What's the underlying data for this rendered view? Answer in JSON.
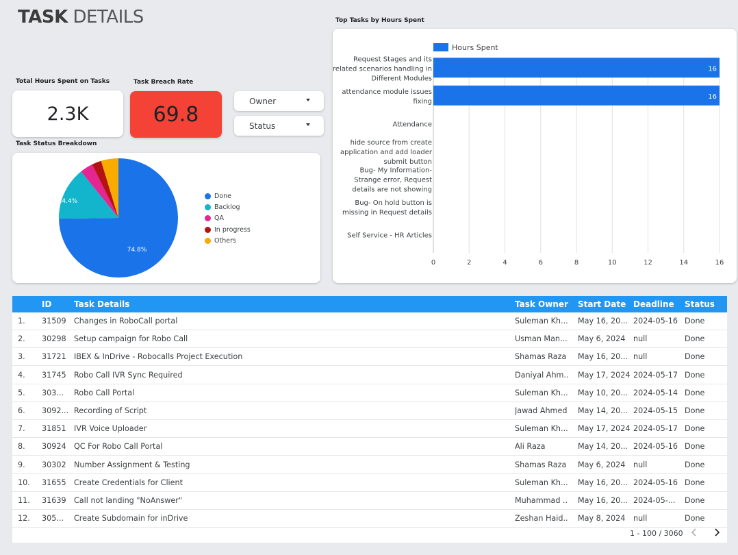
{
  "header": {
    "title_bold": "TASK",
    "title_light": "DETAILS"
  },
  "kpis": {
    "total_hours_label": "Total Hours Spent on Tasks",
    "total_hours_value": "2.3K",
    "breach_label": "Task Breach Rate",
    "breach_value": "69.8",
    "breach_color": "#f44336"
  },
  "filters": {
    "owner_label": "Owner",
    "status_label": "Status"
  },
  "status_breakdown": {
    "title": "Task Status Breakdown",
    "legend": [
      {
        "label": "Done",
        "color": "#1a73e8"
      },
      {
        "label": "Backlog",
        "color": "#12b5cb"
      },
      {
        "label": "QA",
        "color": "#e52592"
      },
      {
        "label": "In progress",
        "color": "#b31412"
      },
      {
        "label": "Others",
        "color": "#f9ab00"
      }
    ],
    "pct_labels": {
      "done": "74.8%",
      "backlog": "14.4%"
    }
  },
  "chart_data": [
    {
      "type": "pie",
      "title": "Task Status Breakdown",
      "labels": [
        "Done",
        "Backlog",
        "QA",
        "In progress",
        "Others"
      ],
      "values": [
        74.8,
        14.4,
        3.5,
        2.6,
        4.7
      ],
      "colors": [
        "#1a73e8",
        "#12b5cb",
        "#e52592",
        "#b31412",
        "#f9ab00"
      ]
    },
    {
      "type": "bar",
      "orientation": "horizontal",
      "title": "Top Tasks by Hours Spent",
      "legend": [
        "Hours Spent"
      ],
      "categories": [
        [
          "Request Stages and its",
          "related scenarios handling in",
          "Different Modules"
        ],
        [
          "attendance module issues",
          "fixing"
        ],
        [
          "Attendance"
        ],
        [
          "hide source from create",
          "application and add loader",
          "submit button"
        ],
        [
          "Bug- My Information-",
          "Strange error, Request",
          "details are not showing"
        ],
        [
          "Bug- On hold button is",
          "missing in Request details"
        ],
        [
          "Self Service - HR Articles"
        ]
      ],
      "values": [
        16,
        16,
        null,
        null,
        null,
        null,
        null
      ],
      "data_labels": [
        "16",
        "16"
      ],
      "xlim": [
        0,
        16
      ],
      "xticks": [
        0,
        2,
        4,
        6,
        8,
        10,
        12,
        14,
        16
      ],
      "bar_color": "#1a73e8",
      "grid": true
    }
  ],
  "table": {
    "headers": {
      "id": "ID",
      "task": "Task Details",
      "owner": "Task Owner",
      "start": "Start Date",
      "deadline": "Deadline",
      "status": "Status"
    },
    "rows": [
      {
        "idx": "1.",
        "id": "31509",
        "task": "Changes in RoboCall portal",
        "owner": "Suleman Kh...",
        "start": "May 16, 20...",
        "deadline": "2024-05-16",
        "status": "Done"
      },
      {
        "idx": "2.",
        "id": "30298",
        "task": "Setup campaign for Robo Call",
        "owner": "Usman Man...",
        "start": "May 6, 2024",
        "deadline": "null",
        "status": "Done"
      },
      {
        "idx": "3.",
        "id": "31721",
        "task": "IBEX & InDrive - Robocalls Project Execution",
        "owner": "Shamas Raza",
        "start": "May 16, 20...",
        "deadline": "null",
        "status": "Done"
      },
      {
        "idx": "4.",
        "id": "31745",
        "task": "Robo Call IVR Sync Required",
        "owner": "Daniyal Ahm...",
        "start": "May 17, 2024",
        "deadline": "2024-05-17",
        "status": "Done"
      },
      {
        "idx": "5.",
        "id": "303...",
        "task": "Robo Call Portal",
        "owner": "Suleman Kh...",
        "start": "May 10, 20...",
        "deadline": "2024-05-14",
        "status": "Done"
      },
      {
        "idx": "6.",
        "id": "3092...",
        "task": "Recording of Script",
        "owner": "Jawad Ahmed",
        "start": "May 14, 20...",
        "deadline": "2024-05-15",
        "status": "Done"
      },
      {
        "idx": "7.",
        "id": "31851",
        "task": "IVR Voice Uploader",
        "owner": "Suleman Kh...",
        "start": "May 17, 2024",
        "deadline": "2024-05-17",
        "status": "Done"
      },
      {
        "idx": "8.",
        "id": "30924",
        "task": "QC For Robo Call Portal",
        "owner": "Ali Raza",
        "start": "May 14, 20...",
        "deadline": "2024-05-16",
        "status": "Done"
      },
      {
        "idx": "9.",
        "id": "30302",
        "task": "Number Assignment & Testing",
        "owner": "Shamas Raza",
        "start": "May 6, 2024",
        "deadline": "null",
        "status": "Done"
      },
      {
        "idx": "10.",
        "id": "31655",
        "task": "Create Credentials for Client",
        "owner": "Suleman Kh...",
        "start": "May 16, 20...",
        "deadline": "2024-05-16",
        "status": "Done"
      },
      {
        "idx": "11.",
        "id": "31639",
        "task": "Call not landing \"NoAnswer\"",
        "owner": "Muhammad ...",
        "start": "May 16, 20...",
        "deadline": "2024-05-...",
        "status": "Done"
      },
      {
        "idx": "12.",
        "id": "305...",
        "task": "Create Subdomain for inDrive",
        "owner": "Zeshan Haid...",
        "start": "May 8, 2024",
        "deadline": "null",
        "status": "Done"
      }
    ],
    "pagination": "1 - 100 / 3060"
  }
}
